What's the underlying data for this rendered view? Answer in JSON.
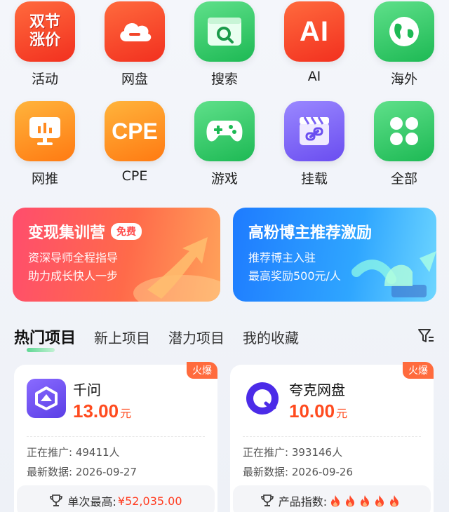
{
  "categories": [
    {
      "label": "活动",
      "tile_text": "双节\n涨价",
      "icon": "promo-icon"
    },
    {
      "label": "网盘",
      "icon": "cloud-icon"
    },
    {
      "label": "搜索",
      "icon": "search-window-icon"
    },
    {
      "label": "AI",
      "tile_text": "AI",
      "icon": "ai-icon"
    },
    {
      "label": "海外",
      "icon": "globe-icon"
    },
    {
      "label": "网推",
      "icon": "monitor-chart-icon"
    },
    {
      "label": "CPE",
      "tile_text": "CPE",
      "icon": "cpe-icon"
    },
    {
      "label": "游戏",
      "icon": "gamepad-icon"
    },
    {
      "label": "挂载",
      "icon": "link-clapper-icon"
    },
    {
      "label": "全部",
      "icon": "four-petal-icon"
    }
  ],
  "banners": {
    "left": {
      "title": "变现集训营",
      "badge": "免费",
      "line1": "资深导师全程指导",
      "line2": "助力成长快人一步"
    },
    "right": {
      "title": "高粉博主推荐激励",
      "line1": "推荐博主入驻",
      "line2": "最高奖励500元/人"
    }
  },
  "tabs": [
    "热门项目",
    "新上项目",
    "潜力项目",
    "我的收藏"
  ],
  "cards": [
    {
      "badge": "火爆",
      "name": "千问",
      "price": "13.00",
      "unit": "元",
      "promoting_label": "正在推广: 49411人",
      "data_label": "最新数据: 2026-09-27",
      "stat_label": "单次最高:",
      "stat_value": "¥52,035.00"
    },
    {
      "badge": "火爆",
      "name": "夸克网盘",
      "price": "10.00",
      "unit": "元",
      "promoting_label": "正在推广: 393146人",
      "data_label": "最新数据: 2026-09-26",
      "stat_label": "产品指数:",
      "flames": 5
    }
  ],
  "colors": {
    "accent_red": "#ff4b1f",
    "hot_badge": "#ff6b3d",
    "green": "#1db954",
    "purple": "#6a4df0"
  }
}
